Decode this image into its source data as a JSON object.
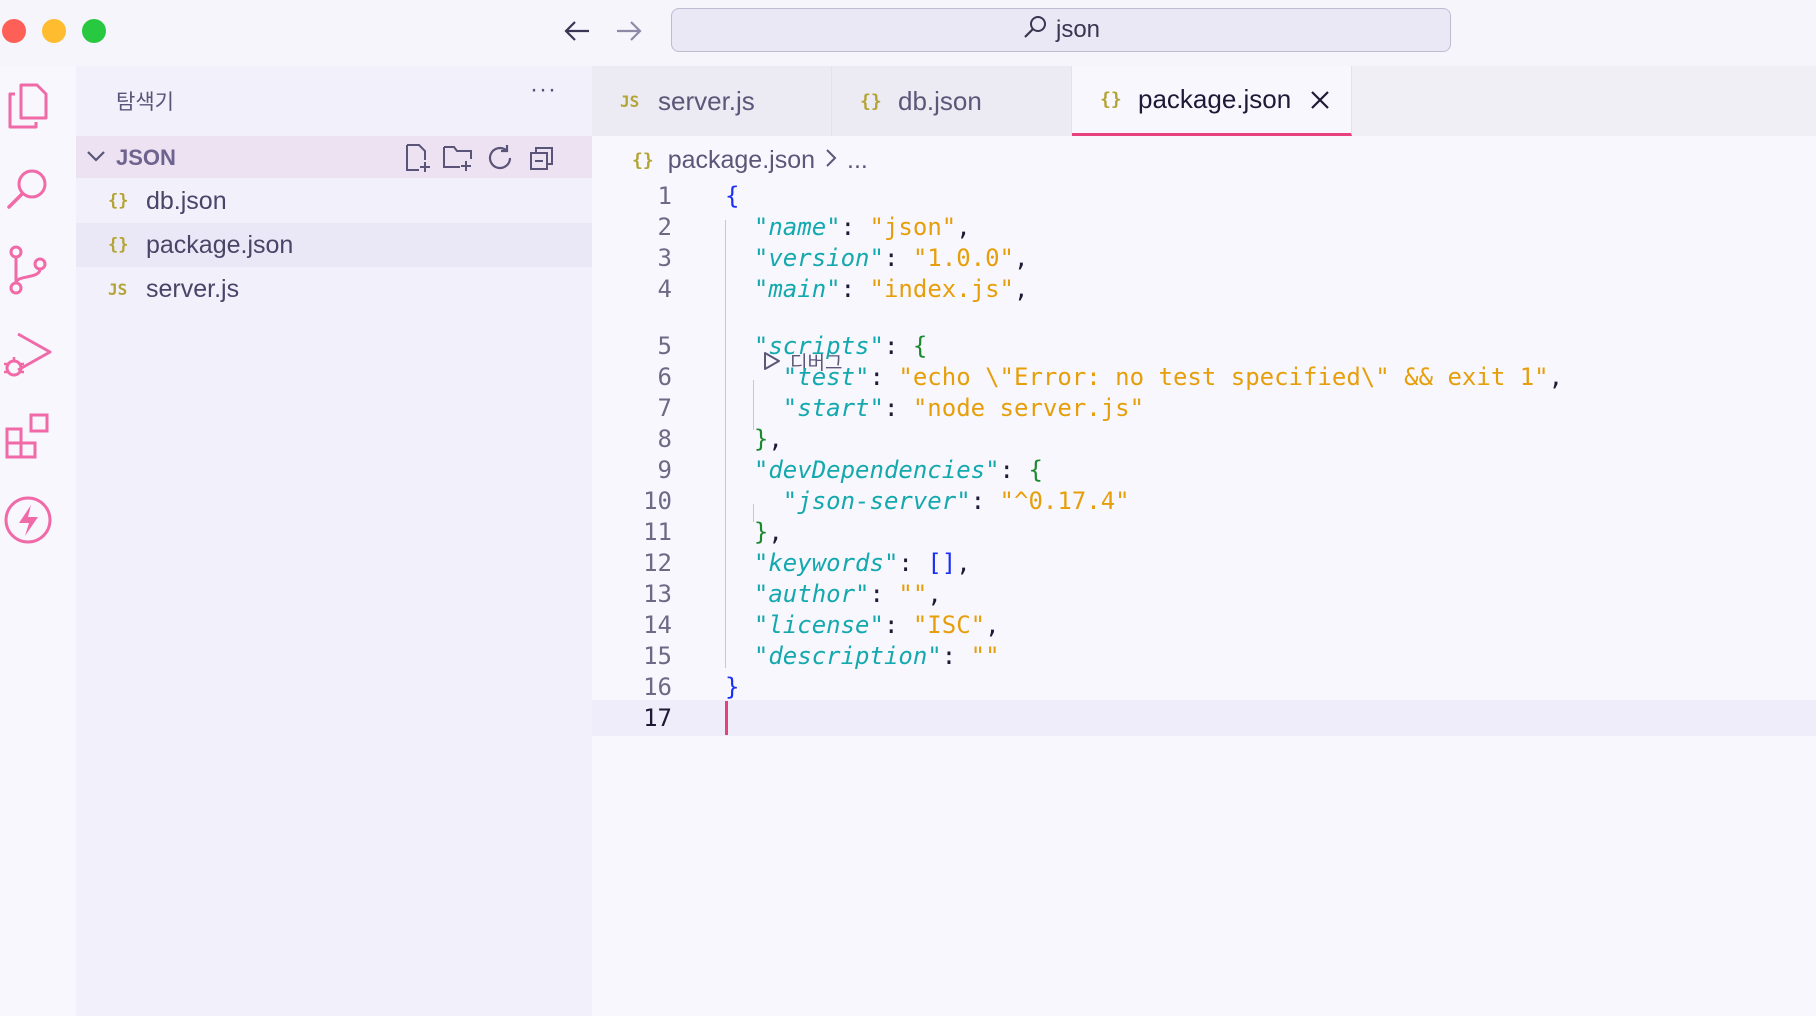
{
  "titlebar": {
    "search_text": "json",
    "back_icon": "arrow-left-icon",
    "forward_icon": "arrow-right-icon"
  },
  "activity_bar": {
    "icons": [
      "files-icon",
      "search-icon",
      "source-control-icon",
      "run-debug-icon",
      "extensions-icon",
      "lightning-icon"
    ],
    "accent": "#f06aa8"
  },
  "sidebar": {
    "title": "탐색기",
    "more": "···",
    "section_label": "JSON",
    "files": [
      {
        "icon": "{}",
        "label": "db.json",
        "type": "json"
      },
      {
        "icon": "{}",
        "label": "package.json",
        "type": "json"
      },
      {
        "icon": "JS",
        "label": "server.js",
        "type": "js"
      }
    ]
  },
  "tabs": [
    {
      "icon": "JS",
      "label": "server.js",
      "active": false
    },
    {
      "icon": "{}",
      "label": "db.json",
      "active": false
    },
    {
      "icon": "{}",
      "label": "package.json",
      "active": true
    }
  ],
  "breadcrumb": {
    "icon": "{}",
    "file": "package.json",
    "separator": ">",
    "rest": "..."
  },
  "codelens": {
    "label": "디버그"
  },
  "code": {
    "lines": [
      {
        "n": "1",
        "tokens": [
          [
            "b1",
            "{"
          ]
        ]
      },
      {
        "n": "2",
        "tokens": [
          [
            "p",
            "  "
          ],
          [
            "k",
            "\"name\""
          ],
          [
            "p",
            ": "
          ],
          [
            "s",
            "\"json\""
          ],
          [
            "p",
            ","
          ]
        ]
      },
      {
        "n": "3",
        "tokens": [
          [
            "p",
            "  "
          ],
          [
            "k",
            "\"version\""
          ],
          [
            "p",
            ": "
          ],
          [
            "s",
            "\"1.0.0\""
          ],
          [
            "p",
            ","
          ]
        ]
      },
      {
        "n": "4",
        "tokens": [
          [
            "p",
            "  "
          ],
          [
            "k",
            "\"main\""
          ],
          [
            "p",
            ": "
          ],
          [
            "s",
            "\"index.js\""
          ],
          [
            "p",
            ","
          ]
        ]
      },
      {
        "n": "5",
        "tokens": [
          [
            "p",
            "  "
          ],
          [
            "k",
            "\"scripts\""
          ],
          [
            "p",
            ": "
          ],
          [
            "b2",
            "{"
          ]
        ]
      },
      {
        "n": "6",
        "tokens": [
          [
            "p",
            "    "
          ],
          [
            "k",
            "\"test\""
          ],
          [
            "p",
            ": "
          ],
          [
            "s",
            "\"echo \\\"Error: no test specified\\\" && exit 1\""
          ],
          [
            "p",
            ","
          ]
        ]
      },
      {
        "n": "7",
        "tokens": [
          [
            "p",
            "    "
          ],
          [
            "k",
            "\"start\""
          ],
          [
            "p",
            ": "
          ],
          [
            "s",
            "\"node server.js\""
          ]
        ]
      },
      {
        "n": "8",
        "tokens": [
          [
            "p",
            "  "
          ],
          [
            "b2",
            "}"
          ],
          [
            "p",
            ","
          ]
        ]
      },
      {
        "n": "9",
        "tokens": [
          [
            "p",
            "  "
          ],
          [
            "k",
            "\"devDependencies\""
          ],
          [
            "p",
            ": "
          ],
          [
            "b2",
            "{"
          ]
        ]
      },
      {
        "n": "10",
        "tokens": [
          [
            "p",
            "    "
          ],
          [
            "k",
            "\"json-server\""
          ],
          [
            "p",
            ": "
          ],
          [
            "s",
            "\"^0.17.4\""
          ]
        ]
      },
      {
        "n": "11",
        "tokens": [
          [
            "p",
            "  "
          ],
          [
            "b2",
            "}"
          ],
          [
            "p",
            ","
          ]
        ]
      },
      {
        "n": "12",
        "tokens": [
          [
            "p",
            "  "
          ],
          [
            "k",
            "\"keywords\""
          ],
          [
            "p",
            ": "
          ],
          [
            "b1",
            "[]"
          ],
          [
            "p",
            ","
          ]
        ]
      },
      {
        "n": "13",
        "tokens": [
          [
            "p",
            "  "
          ],
          [
            "k",
            "\"author\""
          ],
          [
            "p",
            ": "
          ],
          [
            "s",
            "\"\""
          ],
          [
            "p",
            ","
          ]
        ]
      },
      {
        "n": "14",
        "tokens": [
          [
            "p",
            "  "
          ],
          [
            "k",
            "\"license\""
          ],
          [
            "p",
            ": "
          ],
          [
            "s",
            "\"ISC\""
          ],
          [
            "p",
            ","
          ]
        ]
      },
      {
        "n": "15",
        "tokens": [
          [
            "p",
            "  "
          ],
          [
            "k",
            "\"description\""
          ],
          [
            "p",
            ": "
          ],
          [
            "s",
            "\"\""
          ]
        ]
      },
      {
        "n": "16",
        "tokens": [
          [
            "b1",
            "}"
          ]
        ]
      },
      {
        "n": "17",
        "tokens": []
      }
    ],
    "current_line": "17"
  },
  "colors": {
    "accent": "#e6417c",
    "json_icon": "#b3a436",
    "js_icon": "#b3a436",
    "key": "#14a9ae",
    "string": "#e69f0b"
  }
}
